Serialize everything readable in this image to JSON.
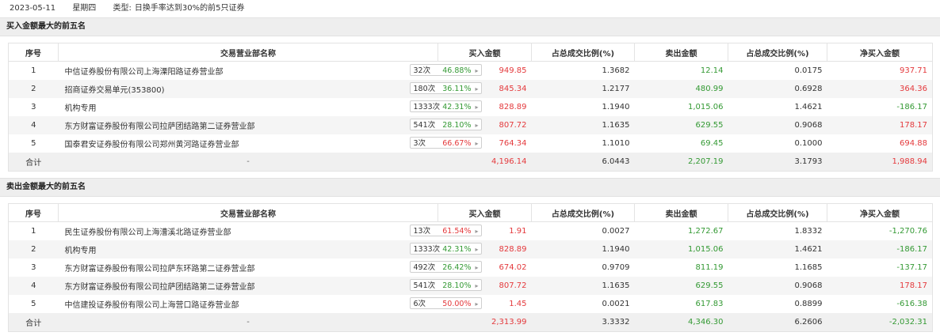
{
  "header": {
    "date": "2023-05-11",
    "weekday": "星期四",
    "type_label": "类型:",
    "type_value": "日换手率达到30%的前5只证券"
  },
  "columns": [
    "序号",
    "交易营业部名称",
    "买入金额",
    "占总成交比例(%)",
    "卖出金额",
    "占总成交比例(%)",
    "净买入金额"
  ],
  "colors": {
    "up": "#e4393c",
    "down": "#339933"
  },
  "buy_section": {
    "title": "买入金额最大的前五名",
    "rows": [
      {
        "idx": "1",
        "name": "中信证券股份有限公司上海溧阳路证券营业部",
        "times": "32次",
        "pct": "46.88%",
        "pct_color": "green",
        "buy": "949.85",
        "buy_ratio": "1.3682",
        "sell": "12.14",
        "sell_ratio": "0.0175",
        "net": "937.71",
        "net_color": "red"
      },
      {
        "idx": "2",
        "name": "招商证券交易单元(353800)",
        "times": "180次",
        "pct": "36.11%",
        "pct_color": "green",
        "buy": "845.34",
        "buy_ratio": "1.2177",
        "sell": "480.99",
        "sell_ratio": "0.6928",
        "net": "364.36",
        "net_color": "red"
      },
      {
        "idx": "3",
        "name": "机构专用",
        "times": "1333次",
        "pct": "42.31%",
        "pct_color": "green",
        "buy": "828.89",
        "buy_ratio": "1.1940",
        "sell": "1,015.06",
        "sell_ratio": "1.4621",
        "net": "-186.17",
        "net_color": "green"
      },
      {
        "idx": "4",
        "name": "东方财富证券股份有限公司拉萨团结路第二证券营业部",
        "times": "541次",
        "pct": "28.10%",
        "pct_color": "green",
        "buy": "807.72",
        "buy_ratio": "1.1635",
        "sell": "629.55",
        "sell_ratio": "0.9068",
        "net": "178.17",
        "net_color": "red"
      },
      {
        "idx": "5",
        "name": "国泰君安证券股份有限公司郑州黄河路证券营业部",
        "times": "3次",
        "pct": "66.67%",
        "pct_color": "red",
        "buy": "764.34",
        "buy_ratio": "1.1010",
        "sell": "69.45",
        "sell_ratio": "0.1000",
        "net": "694.88",
        "net_color": "red"
      }
    ],
    "total": {
      "label": "合计",
      "name": "-",
      "buy": "4,196.14",
      "buy_ratio": "6.0443",
      "sell": "2,207.19",
      "sell_ratio": "3.1793",
      "net": "1,988.94",
      "net_color": "red"
    }
  },
  "sell_section": {
    "title": "卖出金额最大的前五名",
    "rows": [
      {
        "idx": "1",
        "name": "民生证券股份有限公司上海漕溪北路证券营业部",
        "times": "13次",
        "pct": "61.54%",
        "pct_color": "red",
        "buy": "1.91",
        "buy_ratio": "0.0027",
        "sell": "1,272.67",
        "sell_ratio": "1.8332",
        "net": "-1,270.76",
        "net_color": "green"
      },
      {
        "idx": "2",
        "name": "机构专用",
        "times": "1333次",
        "pct": "42.31%",
        "pct_color": "green",
        "buy": "828.89",
        "buy_ratio": "1.1940",
        "sell": "1,015.06",
        "sell_ratio": "1.4621",
        "net": "-186.17",
        "net_color": "green"
      },
      {
        "idx": "3",
        "name": "东方财富证券股份有限公司拉萨东环路第二证券营业部",
        "times": "492次",
        "pct": "26.42%",
        "pct_color": "green",
        "buy": "674.02",
        "buy_ratio": "0.9709",
        "sell": "811.19",
        "sell_ratio": "1.1685",
        "net": "-137.17",
        "net_color": "green"
      },
      {
        "idx": "4",
        "name": "东方财富证券股份有限公司拉萨团结路第二证券营业部",
        "times": "541次",
        "pct": "28.10%",
        "pct_color": "green",
        "buy": "807.72",
        "buy_ratio": "1.1635",
        "sell": "629.55",
        "sell_ratio": "0.9068",
        "net": "178.17",
        "net_color": "red"
      },
      {
        "idx": "5",
        "name": "中信建投证券股份有限公司上海营口路证券营业部",
        "times": "6次",
        "pct": "50.00%",
        "pct_color": "red",
        "buy": "1.45",
        "buy_ratio": "0.0021",
        "sell": "617.83",
        "sell_ratio": "0.8899",
        "net": "-616.38",
        "net_color": "green"
      }
    ],
    "total": {
      "label": "合计",
      "name": "-",
      "buy": "2,313.99",
      "buy_ratio": "3.3332",
      "sell": "4,346.30",
      "sell_ratio": "6.2606",
      "net": "-2,032.31",
      "net_color": "green"
    }
  }
}
